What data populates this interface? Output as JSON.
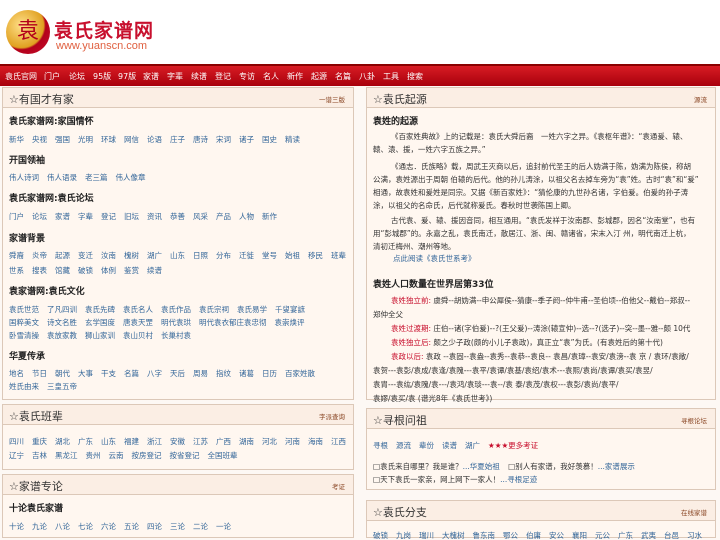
{
  "header": {
    "logo_glyph": "袁",
    "title": "袁氏家谱网",
    "url": "www.yuanscn.com"
  },
  "nav": [
    "袁氏官网",
    "门户",
    "论坛",
    "95版",
    "97版",
    "家谱",
    "字辈",
    "续谱",
    "登记",
    "专访",
    "名人",
    "新作",
    "起源",
    "名篇",
    "八卦",
    "工具",
    "搜索"
  ],
  "left_panel": {
    "title": "有国才有家",
    "more": "一谱三版",
    "sections": [
      {
        "title": "袁氏家谱网:家国情怀",
        "items": [
          "新华",
          "央视",
          "强国",
          "光明",
          "环球",
          "网信",
          "论语",
          "庄子",
          "唐诗",
          "宋词",
          "诸子",
          "国史",
          "精读"
        ]
      },
      {
        "title": "开国领袖",
        "items": [
          "伟人诗词",
          "伟人语录",
          "老三篇",
          "伟人像章"
        ]
      },
      {
        "title": "袁氏家谱网:袁氏论坛",
        "items": [
          "门户",
          "论坛",
          "家谱",
          "字辈",
          "登记",
          "旧坛",
          "资讯",
          "恭善",
          "风采",
          "产品",
          "人物",
          "新作"
        ]
      },
      {
        "title": "家谱背景",
        "items": [
          "舜裔",
          "炎帝",
          "起源",
          "变迁",
          "汝南",
          "槐树",
          "湖广",
          "山东",
          "日照",
          "分布",
          "迁徙",
          "堂号",
          "始祖",
          "移民",
          "班辈"
        ],
        "items2": [
          "世系",
          "搜表",
          "馆藏",
          "破锁",
          "体例",
          "鉴赏",
          "续谱"
        ]
      },
      {
        "title": "袁家谱网:袁氏文化",
        "items": [
          "袁氏世范",
          "了凡四训",
          "袁氏先碑",
          "袁氏名人",
          "袁氏作品",
          "袁氏宗祠",
          "袁氏易学",
          "千叟宴謶"
        ],
        "items2": [
          "国粹美文",
          "诗文名胜",
          "玄学国度",
          "唐袁天罡",
          "明代袁珙",
          "明代袁衣郁庄袁忠彻",
          "袁崇焕评"
        ],
        "items3": [
          "卧雪清操",
          "袁放家教",
          "狮山家训",
          "袁山贝村",
          "长巢村袁"
        ]
      },
      {
        "title": "华夏传承",
        "items": [
          "地名",
          "节日",
          "朝代",
          "大事",
          "干支",
          "名篇",
          "八字",
          "天后",
          "周易",
          "指纹",
          "诸葛",
          "日历",
          "百家姓散"
        ],
        "items2": [
          "姓氏由来",
          "三皇五帝"
        ]
      }
    ]
  },
  "origin_panel": {
    "title": "袁氏起源",
    "more": "源流",
    "sub": "袁姓的起源",
    "paras": [
      "《百家姓典故》上的记载是：袁氏大舜后裔　一姓六字之异。《袁枢年谱》：“袁通爰、辕、",
      "轅、溒、援，一姓六字五族之异。”",
      "《通志．氏族略》载，周武王灭商以后，追封前代圣王的后人妫满于陈，妫满为陈侯，称胡",
      "公满，袁姓源出于周朝 伯辕的后代。他的孙儿涛涂，以祖父名去掉车旁为“袁”姓。古时“袁”和“爰”",
      "相通，故袁姓和爰姓是同宗。又据《新百家姓》：“猜伦康的九世孙名诸，字伯爰。伯爰的孙子涛",
      "涂，以祖父的名命氏，后代就称爰氏。春秋时世袭陈国上卿。",
      "古代袁、爰、辕、援因音同，相互通用。“袁氏发祥于汝南郡、彭城郡，因名“汝南堂”，也有",
      "用“彭城郡”的。永嘉之乱，袁氏南迁，散居江、浙、闽、赣诸省，宋末入汀 州，明代南迁上杭，",
      "清初迁梅州、潮州等地。"
    ],
    "read_more": "点此阅读《袁氏世系考》",
    "pop_title": "袁姓人口数量在世界居第33位",
    "lines": [
      {
        "k": "袁姓独立前:",
        "v": "虞舜--胡妫满--申公犀侯--猜康--季子阏--仲牛甫--圣伯顷--伯他父--戴伯--郑叔--"
      },
      {
        "k": "",
        "v": "郑仲全父"
      },
      {
        "k": "袁姓过渡期:",
        "v": "庄伯--诸(字伯爰)--?(王父爰)--涛涂(辕宣仲)--选--?(选子)--突--墨--雅--颇 10代"
      },
      {
        "k": "袁姓独立后:",
        "v": "颇之少子政(颇的小儿子袁政)，真正立“袁”为氏。(有袁姓后的第十代)"
      },
      {
        "k": "袁政以后:",
        "v": "袁政 --袁固--袁盎--袁秀--袁恭--袁良-- 袁昌/袁璋--袁安/袁滂--袁 京 / 袁环/袁敞/"
      },
      {
        "k": "",
        "v": "袁贺---袁彭/袁成/袁逢/袁隗---袁平/袁谭/袁基/袁绍/袁术---袁熙/袁尚/袁谭/袁买/袁昱/"
      },
      {
        "k": "",
        "v": "袁胄---袁纮/袁隗/袁---/袁鸿/袁琰---袁--/袁 泰/袁茂/袁权---袁彭/袁尚/袁平/"
      },
      {
        "k": "",
        "v": "袁嫪/袁买/袁 (谱光8年《袁氏世考》)"
      }
    ]
  },
  "peers_panel": {
    "title": "袁氏班辈",
    "more": "字派查询",
    "row1": [
      "四川",
      "重庆",
      "湖北",
      "广东",
      "山东",
      "福建",
      "浙江",
      "安徽",
      "江苏",
      "广西",
      "湖南",
      "河北",
      "河南",
      "海南",
      "江西"
    ],
    "row2": [
      "辽宁",
      "吉林",
      "黑龙江",
      "贵州",
      "云南",
      "按房登记",
      "按省登记",
      "全国班辈"
    ]
  },
  "search_panel": {
    "title": "寻根问祖",
    "more": "寻根论坛",
    "row1": [
      "寻根",
      "源流",
      "辈份",
      "读谱",
      "湖广"
    ],
    "row1_red": "★★★更多考证",
    "q1": "□袁氏来自哪里？我是谁？",
    "q1_link": "...华夏始祖",
    "q2": "□别人有家谱，我好羡慕！",
    "q2_link": "...家谱展示",
    "q3": "□天下袁氏一家亲，网上网下一家人！",
    "q3_link": "...寻根足迹"
  },
  "expert_panel": {
    "title": "家谱专论",
    "more": "考证",
    "sub": "十论袁氏家谱",
    "items": [
      "十论",
      "九论",
      "八论",
      "七论",
      "六论",
      "五论",
      "四论",
      "三论",
      "二论",
      "一论"
    ]
  },
  "branch_panel": {
    "title": "袁氏分支",
    "more": "在线家谱",
    "items": [
      "破锁",
      "九岗",
      "瑞川",
      "大槐树",
      "鲁东南",
      "鄂公",
      "伯庸",
      "安公",
      "襄阳",
      "元公",
      "广东",
      "武夷",
      "台邑",
      "习水"
    ]
  }
}
